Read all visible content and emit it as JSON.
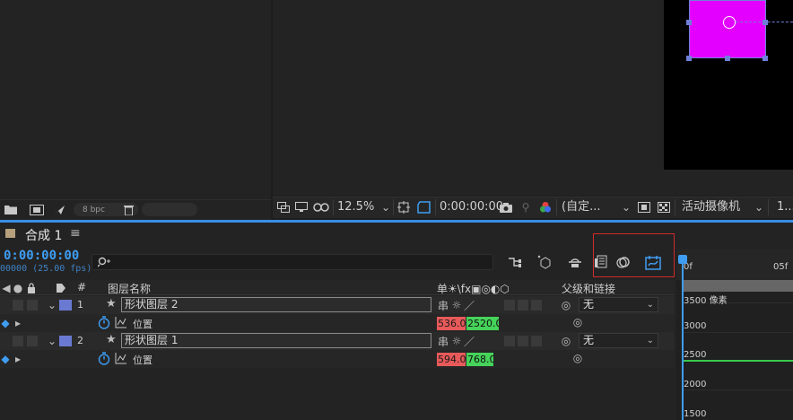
{
  "project_panel": {
    "bit_depth": "8 bpc",
    "icons": [
      "folder-icon",
      "composition-icon",
      "render-queue-icon",
      "trash-icon"
    ]
  },
  "viewer": {
    "zoom": "12.5%",
    "timecode": "0:00:00:00",
    "resolution": "(自定...",
    "camera": "活动摄像机",
    "views": "1..."
  },
  "timeline": {
    "tab_title": "合成 1",
    "tab_menu": "≡",
    "current_time": "0:00:00:00",
    "fps_label": "00000 (25.00 fps)",
    "search_placeholder": "",
    "columns": {
      "number": "#",
      "layer_name": "图层名称",
      "switches": "单☀\\fx▣◎◐⬡",
      "parent": "父级和链接"
    },
    "layers": [
      {
        "number": "1",
        "name": "形状图层 2",
        "parent": "无",
        "property": "位置",
        "value_x": "536.0,",
        "value_y": "2520.0"
      },
      {
        "number": "2",
        "name": "形状图层 1",
        "parent": "无",
        "property": "位置",
        "value_x": "594.0,",
        "value_y": "768.0"
      }
    ]
  },
  "graph_editor": {
    "ruler_labels": [
      "0f",
      "05f"
    ],
    "y_labels": [
      "3500 像素",
      "3000",
      "2500",
      "2000",
      "1500"
    ]
  },
  "colors": {
    "accent_blue": "#3f9df2",
    "shape_magenta": "#e400ff",
    "highlight_red": "#d02b2b",
    "value_red": "#e85a5a",
    "value_green": "#46d35a",
    "label_blue": "#6a7ad2"
  }
}
